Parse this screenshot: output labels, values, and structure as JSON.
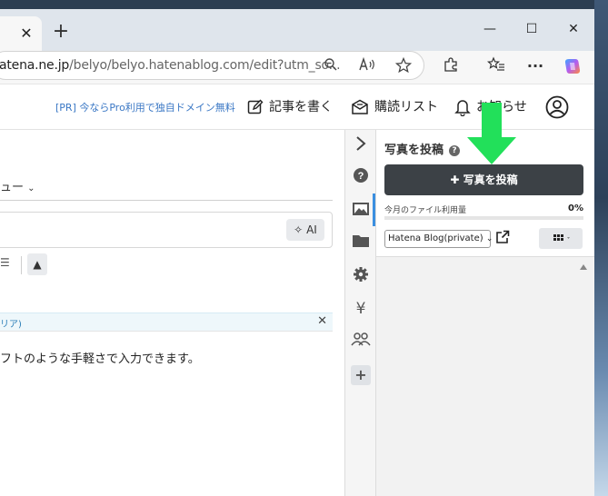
{
  "browser": {
    "tab_close": "✕",
    "new_tab": "+",
    "window_controls": {
      "minimize": "—",
      "maximize": "☐",
      "close": "✕"
    },
    "url_domain": "atena.ne.jp",
    "url_rest": "/belyo/belyo.hatenablog.com/edit?utm_so...",
    "icons": [
      "zoom-icon",
      "read-aloud-icon",
      "favorite-star-icon",
      "extensions-icon",
      "favorites-icon",
      "more-icon",
      "copilot-icon"
    ],
    "more_label": "···"
  },
  "header": {
    "promo": "[PR] 今ならPro利用で独自ドメイン無料",
    "write": "記事を書く",
    "reading_list": "購読リスト",
    "notifications": "お知らせ"
  },
  "editor": {
    "menu_partial": "ュー",
    "ai_label": "AI",
    "hint_partial": "リア)",
    "hint_close": "✕",
    "body_partial": "フトのような手軽さで入力できます。"
  },
  "photo_panel": {
    "title": "写真を投稿",
    "help": "?",
    "upload_button": "写真を投稿",
    "usage_label": "今月のファイル利用量",
    "usage_percent": "0%",
    "usage_fraction": 0,
    "blog_select": "Hatena Blog(private)"
  },
  "colors": {
    "accent_blue": "#3b8fe0",
    "upload_bg": "#3c4146",
    "annotation_green": "#22e05a",
    "promo_link": "#3b78c5"
  }
}
